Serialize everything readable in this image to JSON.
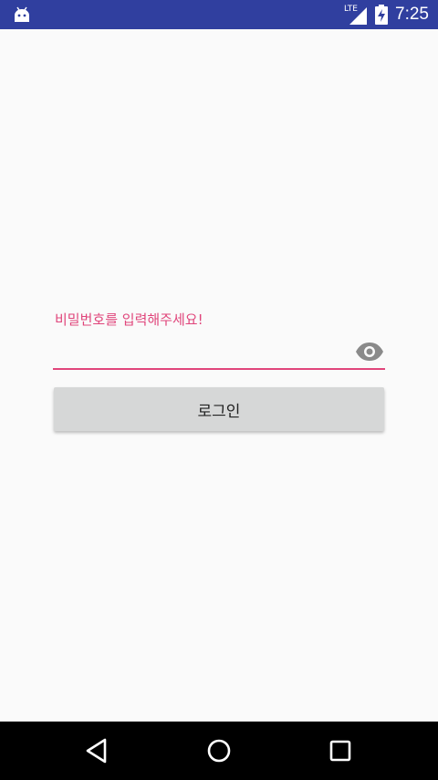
{
  "status_bar": {
    "network_type": "LTE",
    "time": "7:25",
    "icons": [
      "android-notification-icon",
      "cell-signal-icon",
      "battery-charging-icon"
    ]
  },
  "login_form": {
    "password_label": "비밀번호를 입력해주세요!",
    "password_value": "",
    "visibility_toggle_icon": "eye-icon",
    "login_button_label": "로그인"
  },
  "navigation_bar": {
    "icons": [
      "back-icon",
      "home-icon",
      "recents-icon"
    ]
  },
  "colors": {
    "status_bar": "#303f9f",
    "accent": "#e0457b",
    "background": "#fafafa",
    "button": "#d6d7d7",
    "nav_bar": "#000000"
  }
}
